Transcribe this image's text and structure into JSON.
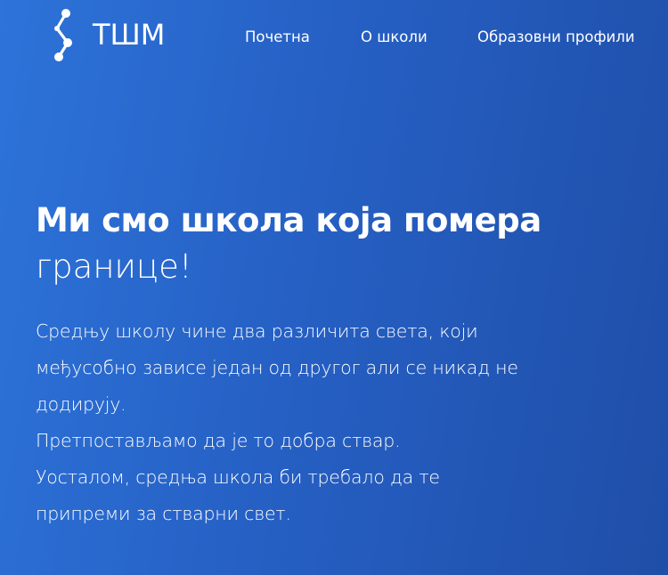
{
  "brand": {
    "logo_text": "ТШМ",
    "logo_icon": "connected-nodes-icon"
  },
  "nav": {
    "items": [
      {
        "label": "Почетна"
      },
      {
        "label": "О школи"
      },
      {
        "label": "Образовни профили"
      }
    ]
  },
  "hero": {
    "title_bold": "Ми смо школа која помера",
    "title_light": "границе!",
    "lines": [
      "Средњу школу чине два различита света, који",
      "међусобно зависе један од другог али се никад не",
      "додирују.",
      "Претпостављамо да је то добра ствар.",
      "Уосталом, средња школа би требало да те",
      "припреми за стварни свет."
    ]
  },
  "colors": {
    "background_start": "#2d73d9",
    "background_end": "#1f4ea8",
    "text": "#ffffff"
  }
}
